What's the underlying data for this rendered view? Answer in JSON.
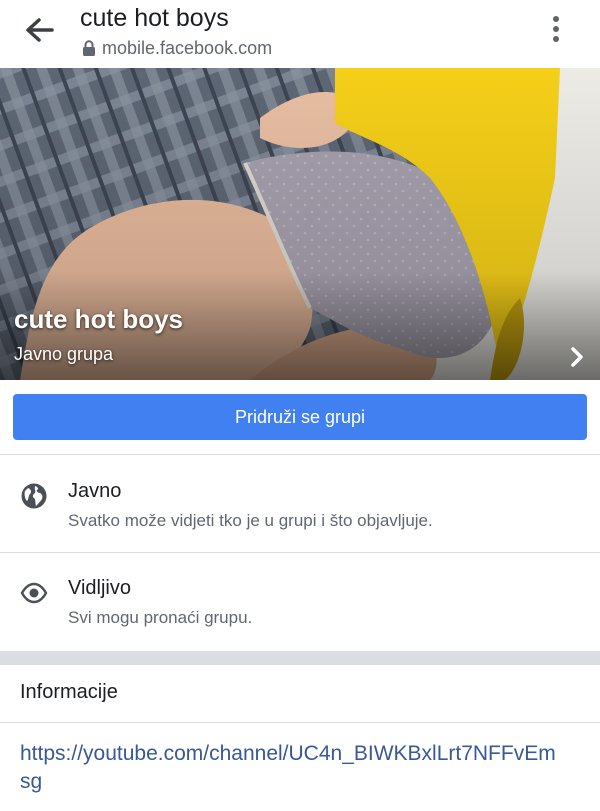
{
  "browser": {
    "title": "cute hot boys",
    "url": "mobile.facebook.com",
    "icons": [
      "back-arrow-icon",
      "lock-icon",
      "more-vertical-icon"
    ]
  },
  "cover": {
    "group_name": "cute hot boys",
    "group_type": "Javno grupa",
    "icon": "chevron-right-icon"
  },
  "join_button": {
    "label": "Pridruži se grupi",
    "color": "#4080f1"
  },
  "privacy": {
    "title": "Javno",
    "description": "Svatko može vidjeti tko je u grupi i što objavljuje.",
    "icon": "globe-icon"
  },
  "visibility": {
    "title": "Vidljivo",
    "description": "Svi mogu pronaći grupu.",
    "icon": "eye-icon"
  },
  "info": {
    "heading": "Informacije",
    "link": "https://youtube.com/channel/UC4n_BIWKBxlLrt7NFFvEmsg",
    "link_color": "#385898"
  }
}
